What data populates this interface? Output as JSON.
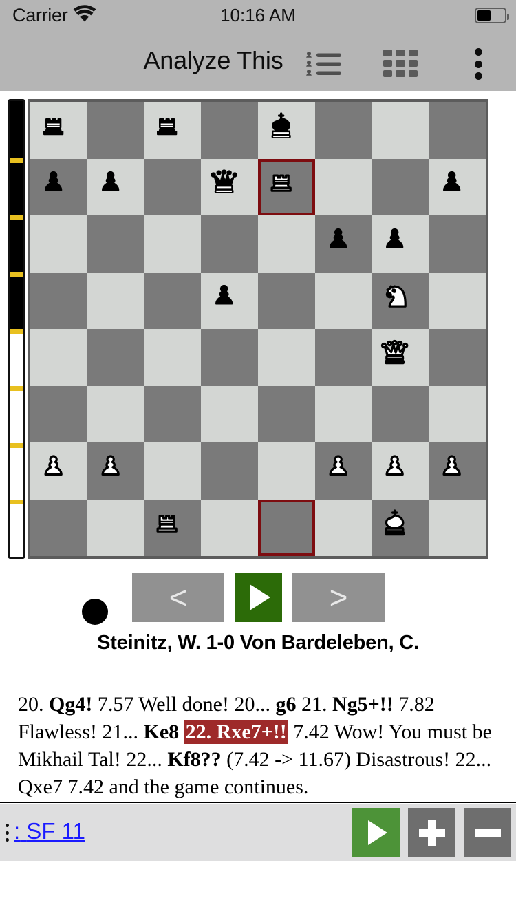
{
  "status_bar": {
    "carrier": "Carrier",
    "wifi_icon": "wifi-icon",
    "time": "10:16 AM",
    "battery_icon": "battery-icon",
    "battery_level_pct": 45
  },
  "nav_bar": {
    "title": "Analyze This",
    "move_list_icon": "move-list-icon",
    "grid_icon": "grid-icon",
    "overflow_icon": "overflow-menu-icon"
  },
  "eval_bar": {
    "black_fraction_pct": 50,
    "white_fraction_pct": 50,
    "tick_color": "#e8c020",
    "black_color": "#000000",
    "white_color": "#ffffff"
  },
  "board": {
    "light_square_color": "#d3d6d3",
    "dark_square_color": "#7a7a7a",
    "highlight_border_color": "#7d0d10",
    "orientation": "white-bottom",
    "highlighted_squares": [
      "e7",
      "e1"
    ],
    "fen": "r1r1k3/pp1qR2p/5pp1/3p2N1/6Q1/8/PP3PPP/2R3K1",
    "ranks": [
      [
        {
          "square": "a8",
          "piece": "black-rook"
        },
        {
          "square": "b8",
          "piece": null
        },
        {
          "square": "c8",
          "piece": "black-rook"
        },
        {
          "square": "d8",
          "piece": null
        },
        {
          "square": "e8",
          "piece": "black-king"
        },
        {
          "square": "f8",
          "piece": null
        },
        {
          "square": "g8",
          "piece": null
        },
        {
          "square": "h8",
          "piece": null
        }
      ],
      [
        {
          "square": "a7",
          "piece": "black-pawn"
        },
        {
          "square": "b7",
          "piece": "black-pawn"
        },
        {
          "square": "c7",
          "piece": null
        },
        {
          "square": "d7",
          "piece": "black-queen"
        },
        {
          "square": "e7",
          "piece": "white-rook",
          "highlight": true
        },
        {
          "square": "f7",
          "piece": null
        },
        {
          "square": "g7",
          "piece": null
        },
        {
          "square": "h7",
          "piece": "black-pawn"
        }
      ],
      [
        {
          "square": "a6",
          "piece": null
        },
        {
          "square": "b6",
          "piece": null
        },
        {
          "square": "c6",
          "piece": null
        },
        {
          "square": "d6",
          "piece": null
        },
        {
          "square": "e6",
          "piece": null
        },
        {
          "square": "f6",
          "piece": "black-pawn"
        },
        {
          "square": "g6",
          "piece": "black-pawn"
        },
        {
          "square": "h6",
          "piece": null
        }
      ],
      [
        {
          "square": "a5",
          "piece": null
        },
        {
          "square": "b5",
          "piece": null
        },
        {
          "square": "c5",
          "piece": null
        },
        {
          "square": "d5",
          "piece": "black-pawn"
        },
        {
          "square": "e5",
          "piece": null
        },
        {
          "square": "f5",
          "piece": null
        },
        {
          "square": "g5",
          "piece": "white-knight"
        },
        {
          "square": "h5",
          "piece": null
        }
      ],
      [
        {
          "square": "a4",
          "piece": null
        },
        {
          "square": "b4",
          "piece": null
        },
        {
          "square": "c4",
          "piece": null
        },
        {
          "square": "d4",
          "piece": null
        },
        {
          "square": "e4",
          "piece": null
        },
        {
          "square": "f4",
          "piece": null
        },
        {
          "square": "g4",
          "piece": "white-queen"
        },
        {
          "square": "h4",
          "piece": null
        }
      ],
      [
        {
          "square": "a3",
          "piece": null
        },
        {
          "square": "b3",
          "piece": null
        },
        {
          "square": "c3",
          "piece": null
        },
        {
          "square": "d3",
          "piece": null
        },
        {
          "square": "e3",
          "piece": null
        },
        {
          "square": "f3",
          "piece": null
        },
        {
          "square": "g3",
          "piece": null
        },
        {
          "square": "h3",
          "piece": null
        }
      ],
      [
        {
          "square": "a2",
          "piece": "white-pawn"
        },
        {
          "square": "b2",
          "piece": "white-pawn"
        },
        {
          "square": "c2",
          "piece": null
        },
        {
          "square": "d2",
          "piece": null
        },
        {
          "square": "e2",
          "piece": null
        },
        {
          "square": "f2",
          "piece": "white-pawn"
        },
        {
          "square": "g2",
          "piece": "white-pawn"
        },
        {
          "square": "h2",
          "piece": "white-pawn"
        }
      ],
      [
        {
          "square": "a1",
          "piece": null
        },
        {
          "square": "b1",
          "piece": null
        },
        {
          "square": "c1",
          "piece": "white-rook"
        },
        {
          "square": "d1",
          "piece": null
        },
        {
          "square": "e1",
          "piece": null,
          "highlight": true
        },
        {
          "square": "f1",
          "piece": null
        },
        {
          "square": "g1",
          "piece": "white-king"
        },
        {
          "square": "h1",
          "piece": null
        }
      ]
    ]
  },
  "controls": {
    "turn_indicator": "black-to-move-dot",
    "prev_label": "<",
    "play_icon": "play-icon",
    "next_label": ">",
    "play_button_color": "#2c6b08",
    "button_color": "#919191"
  },
  "players": {
    "line": "Steinitz, W.  1-0  Von Bardeleben, C.",
    "white": "Steinitz, W.",
    "result": "1-0",
    "black": "Von Bardeleben, C."
  },
  "analysis": {
    "highlight_color": "#9e2a2a",
    "segments": [
      {
        "text": "20. ",
        "style": "normal"
      },
      {
        "text": "Qg4!",
        "style": "bold"
      },
      {
        "text": " 7.57 Well done! 20... ",
        "style": "normal"
      },
      {
        "text": "g6",
        "style": "bold"
      },
      {
        "text": " 21. ",
        "style": "normal"
      },
      {
        "text": "Ng5+!!",
        "style": "bold"
      },
      {
        "text": " 7.82 Flawless! 21... ",
        "style": "normal"
      },
      {
        "text": "Ke8",
        "style": "bold"
      },
      {
        "text": " ",
        "style": "normal"
      },
      {
        "text": "22. Rxe7+!!",
        "style": "highlight"
      },
      {
        "text": " 7.42 Wow! You must be Mikhail Tal! 22... ",
        "style": "normal"
      },
      {
        "text": "Kf8??",
        "style": "bold"
      },
      {
        "text": " (7.42 -> 11.67) Disastrous! 22... Qxe7 7.42 and the game continues.",
        "style": "normal"
      }
    ]
  },
  "engine_bar": {
    "prefix": ":",
    "engine_name": "SF 11",
    "go_icon": "play-icon",
    "plus_icon": "plus-icon",
    "minus_icon": "minus-icon",
    "go_color": "#4d9338",
    "button_color": "#6e6e6e",
    "link_color": "#1a1aff"
  }
}
